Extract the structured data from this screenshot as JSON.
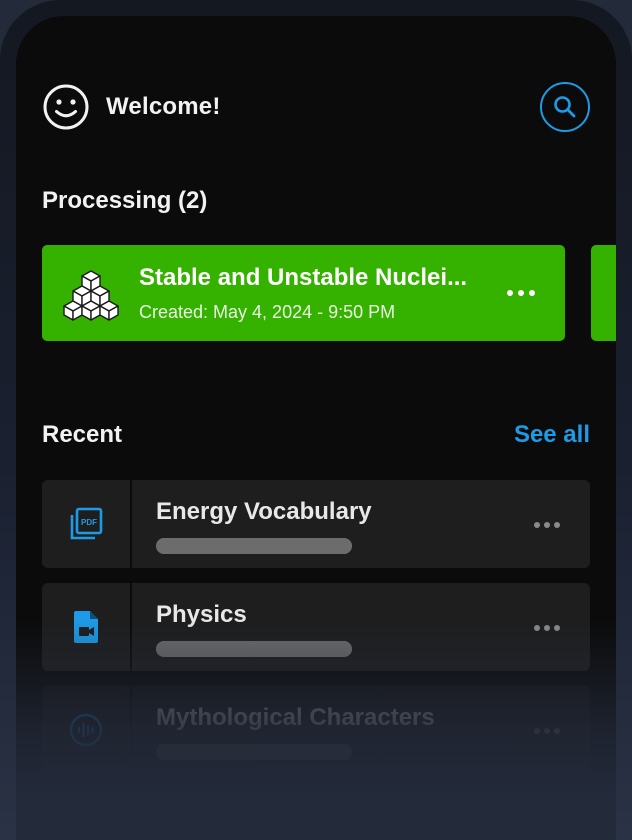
{
  "header": {
    "welcome": "Welcome!",
    "avatar_icon": "smile-face-icon",
    "search_icon": "search-icon"
  },
  "processing": {
    "title": "Processing (2)",
    "cards": [
      {
        "title": "Stable and Unstable Nuclei...",
        "created": "Created: May 4, 2024 - 9:50 PM",
        "icon": "cubes-icon",
        "color": "#35b100"
      }
    ]
  },
  "recent": {
    "title": "Recent",
    "see_all": "See all",
    "items": [
      {
        "title": "Energy Vocabulary",
        "icon": "pdf-icon",
        "progress": 1.0
      },
      {
        "title": "Physics",
        "icon": "video-file-icon",
        "progress": 1.0
      },
      {
        "title": "Mythological Characters",
        "icon": "audio-icon",
        "progress": 1.0
      }
    ]
  },
  "colors": {
    "accent": "#1e9be6",
    "processing_card": "#35b100",
    "background": "#0b0b0b",
    "card": "#1e1e1f"
  }
}
